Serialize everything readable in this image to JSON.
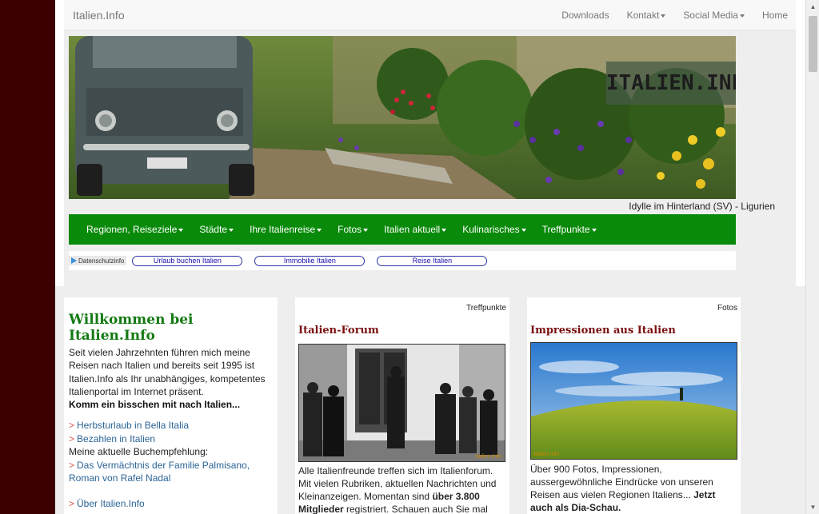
{
  "topnav": {
    "brand": "Italien.Info",
    "items": [
      {
        "label": "Downloads",
        "dropdown": false
      },
      {
        "label": "Kontakt",
        "dropdown": true
      },
      {
        "label": "Social Media",
        "dropdown": true
      },
      {
        "label": "Home",
        "dropdown": false
      }
    ]
  },
  "banner": {
    "logo_text": "ITALIEN.INFO",
    "caption": "Idylle im Hinterland (SV) - Ligurien"
  },
  "mainnav": {
    "items": [
      "Regionen, Reiseziele",
      "Städte",
      "Ihre Italienreise",
      "Fotos",
      "Italien aktuell",
      "Kulinarisches",
      "Treffpunkte"
    ]
  },
  "adbar": {
    "privacy_label": "Datenschutzinfo",
    "links": [
      "Urlaub buchen Italien",
      "Immobilie Italien",
      "Reise Italien"
    ]
  },
  "welcome": {
    "title": "Willkommen bei Italien.Info",
    "intro": "Seit vielen Jahrzehnten führen mich meine Reisen nach Italien und bereits seit 1995 ist Italien.Info als Ihr unabhängiges, kompetentes Italienportal im Internet präsent.",
    "intro_bold": "Komm ein bisschen mit nach Italien...",
    "link1": "Herbsturlaub in Bella Italia",
    "link2": "Bezahlen in Italien",
    "book_label": "Meine aktuelle Buchempfehlung:",
    "link3": "Das Vermächtnis der Familie Palmisano, Roman von Rafel Nadal",
    "about_link": "Über Italien.Info"
  },
  "forum": {
    "tag": "Treffpunkte",
    "title": "Italien-Forum",
    "desc_start": "Alle Italienfreunde treffen sich im Italienforum. Mit vielen Rubriken, aktuellen Nachrichten und Kleinanzeigen. Momentan sind ",
    "desc_bold": "über 3.800 Mitglieder",
    "desc_end": " registriert. Schauen auch Sie mal",
    "watermark": "Italien.Info"
  },
  "fotos": {
    "tag": "Fotos",
    "title": "Impressionen aus Italien",
    "desc_start": "Über 900 Fotos, Impressionen, aussergewöhnliche Eindrücke von unseren Reisen aus vielen Regionen Italiens... ",
    "desc_bold": "Jetzt auch als Dia-Schau.",
    "watermark": "Italien.Info"
  },
  "colors": {
    "brand_green": "#0a8a0a",
    "title_green": "#127a12",
    "title_red": "#7a1010",
    "link_blue": "#2a6496",
    "arrow_red": "#d9534f",
    "body_bg": "#3c0000"
  }
}
